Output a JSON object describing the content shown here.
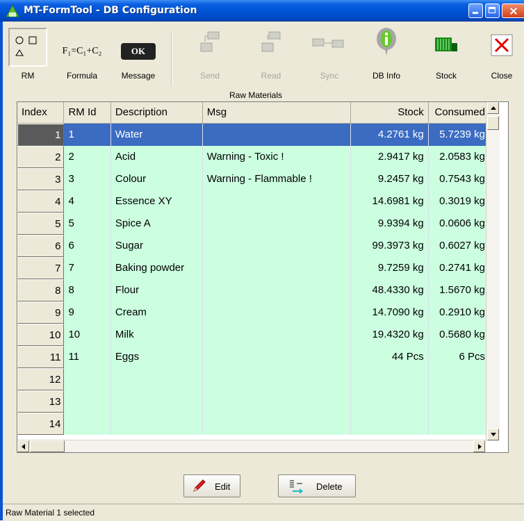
{
  "window": {
    "title": "MT-FormTool - DB Configuration"
  },
  "toolbar": {
    "rm": "RM",
    "formula": "Formula",
    "formula_text": "F₁=C₁+C₂",
    "message": "Message",
    "ok_text": "OK",
    "send": "Send",
    "read": "Read",
    "sync": "Sync",
    "db_info": "DB Info",
    "stock": "Stock",
    "close": "Close"
  },
  "section_title": "Raw Materials",
  "grid": {
    "headers": [
      "Index",
      "RM Id",
      "Description",
      "Msg",
      "Stock",
      "Consumed"
    ],
    "rows": [
      {
        "index": "1",
        "id": "1",
        "desc": "Water",
        "msg": "",
        "stock": "4.2761 kg",
        "consumed": "5.7239 kg"
      },
      {
        "index": "2",
        "id": "2",
        "desc": "Acid",
        "msg": "Warning - Toxic !",
        "stock": "2.9417 kg",
        "consumed": "2.0583 kg"
      },
      {
        "index": "3",
        "id": "3",
        "desc": "Colour",
        "msg": "Warning - Flammable !",
        "stock": "9.2457 kg",
        "consumed": "0.7543 kg"
      },
      {
        "index": "4",
        "id": "4",
        "desc": "Essence XY",
        "msg": "",
        "stock": "14.6981 kg",
        "consumed": "0.3019 kg"
      },
      {
        "index": "5",
        "id": "5",
        "desc": "Spice A",
        "msg": "",
        "stock": "9.9394 kg",
        "consumed": "0.0606 kg"
      },
      {
        "index": "6",
        "id": "6",
        "desc": "Sugar",
        "msg": "",
        "stock": "99.3973 kg",
        "consumed": "0.6027 kg"
      },
      {
        "index": "7",
        "id": "7",
        "desc": "Baking powder",
        "msg": "",
        "stock": "9.7259 kg",
        "consumed": "0.2741 kg"
      },
      {
        "index": "8",
        "id": "8",
        "desc": "Flour",
        "msg": "",
        "stock": "48.4330 kg",
        "consumed": "1.5670 kg"
      },
      {
        "index": "9",
        "id": "9",
        "desc": "Cream",
        "msg": "",
        "stock": "14.7090 kg",
        "consumed": "0.2910 kg"
      },
      {
        "index": "10",
        "id": "10",
        "desc": "Milk",
        "msg": "",
        "stock": "19.4320 kg",
        "consumed": "0.5680 kg"
      },
      {
        "index": "11",
        "id": "11",
        "desc": "Eggs",
        "msg": "",
        "stock": "44 Pcs",
        "consumed": "6 Pcs"
      },
      {
        "index": "12",
        "id": "",
        "desc": "",
        "msg": "",
        "stock": "",
        "consumed": ""
      },
      {
        "index": "13",
        "id": "",
        "desc": "",
        "msg": "",
        "stock": "",
        "consumed": ""
      },
      {
        "index": "14",
        "id": "",
        "desc": "",
        "msg": "",
        "stock": "",
        "consumed": ""
      }
    ]
  },
  "buttons": {
    "edit": "Edit",
    "delete": "Delete"
  },
  "status": "Raw Material 1 selected",
  "colors": {
    "row_bg": "#ccffe0",
    "selected": "#3b6cc1",
    "titlebar": "#0053d6"
  }
}
